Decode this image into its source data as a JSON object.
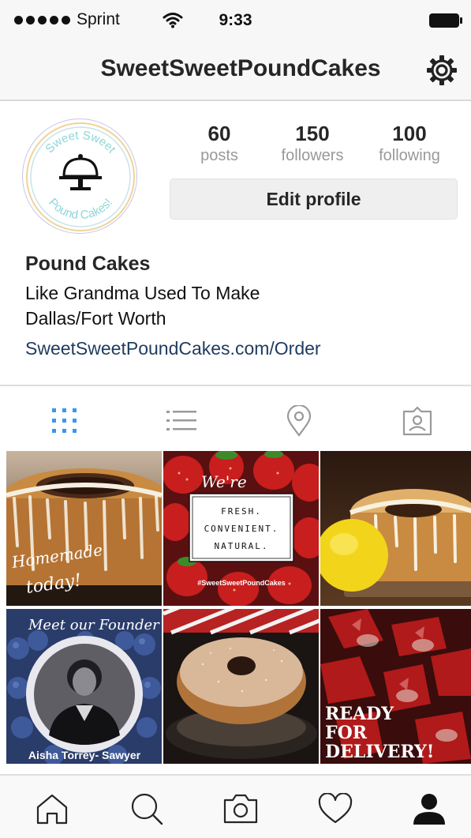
{
  "status_bar": {
    "carrier": "Sprint",
    "time": "9:33"
  },
  "header": {
    "username": "SweetSweetPoundCakes",
    "settings_icon": "gear-icon"
  },
  "avatar": {
    "ring_top_text": "Sweet Sweet",
    "ring_bottom_text": "Pound Cakes!",
    "icon": "cake-stand-icon"
  },
  "stats": [
    {
      "value": "60",
      "label": "posts"
    },
    {
      "value": "150",
      "label": "followers"
    },
    {
      "value": "100",
      "label": "following"
    }
  ],
  "edit_profile_label": "Edit profile",
  "bio": {
    "name": "Pound Cakes",
    "line1": "Like Grandma Used To Make",
    "line2": "Dallas/Fort Worth",
    "link": "SweetSweetPoundCakes.com/Order"
  },
  "view_tabs": [
    {
      "name": "grid-view",
      "icon": "grid-icon",
      "active": true
    },
    {
      "name": "list-view",
      "icon": "list-icon",
      "active": false
    },
    {
      "name": "location-view",
      "icon": "location-pin-icon",
      "active": false
    },
    {
      "name": "tagged-view",
      "icon": "tagged-person-icon",
      "active": false
    }
  ],
  "posts": [
    {
      "overlay_text": [
        "Homemade",
        "today!"
      ]
    },
    {
      "overlay_text": [
        "We're",
        "FRESH.",
        "CONVENIENT.",
        "NATURAL.",
        "#SweetSweetPoundCakes"
      ]
    },
    {
      "overlay_text": []
    },
    {
      "overlay_text": [
        "Meet our Founder",
        "Aisha Torrey- Sawyer"
      ]
    },
    {
      "overlay_text": []
    },
    {
      "overlay_text": [
        "READY",
        "FOR",
        "DELIVERY!"
      ]
    }
  ],
  "bottom_nav": [
    {
      "name": "home",
      "icon": "home-icon"
    },
    {
      "name": "search",
      "icon": "search-icon"
    },
    {
      "name": "camera",
      "icon": "camera-icon"
    },
    {
      "name": "activity",
      "icon": "heart-icon"
    },
    {
      "name": "profile",
      "icon": "profile-icon",
      "active": true
    }
  ],
  "colors": {
    "active_tab": "#3897f0",
    "link": "#1f3b5f",
    "muted": "#999999"
  }
}
